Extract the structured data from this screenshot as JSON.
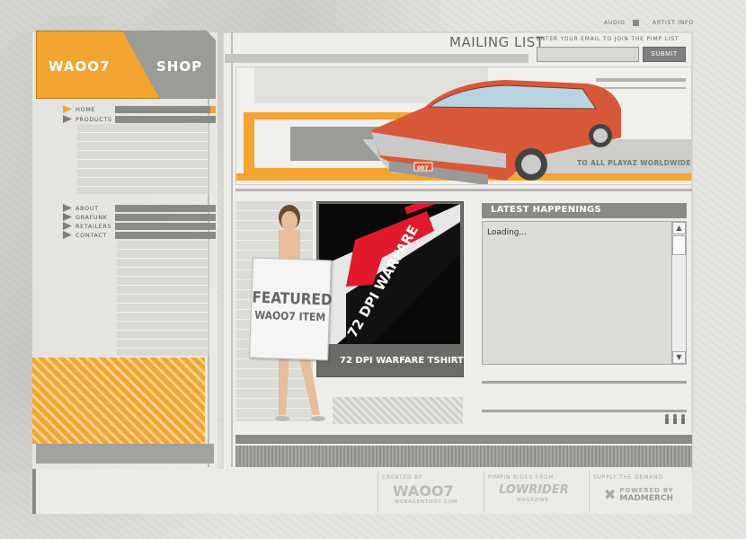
{
  "header": {
    "logo_left": "WAOO7",
    "logo_right": "SHOP",
    "top_links": [
      "AUDIO",
      "ARTIST INFO"
    ],
    "mailing": {
      "title": "MAILING LIST",
      "prompt": "ENTER YOUR EMAIL TO JOIN THE PIMP LIST",
      "input_value": "",
      "submit_label": "SUBMIT"
    }
  },
  "nav": {
    "primary": [
      {
        "label": "HOME",
        "active": true
      },
      {
        "label": "PRODUCTS",
        "active": false
      }
    ],
    "secondary": [
      {
        "label": "ABOUT"
      },
      {
        "label": "GRAFUNK"
      },
      {
        "label": "RETAILERS"
      },
      {
        "label": "CONTACT"
      }
    ]
  },
  "hero": {
    "tagline": "TO ALL PLAYAZ WORLDWIDE",
    "plate": "007"
  },
  "featured": {
    "sign_line1": "FEATURED",
    "sign_line2": "WAOO7 ITEM",
    "product_title": "72 DPI WARFARE",
    "product_label": "72 DPI WARFARE TSHIRT"
  },
  "news": {
    "title": "LATEST HAPPENINGS",
    "text": "Loading...",
    "scroll_up": "▲",
    "scroll_down": "▼"
  },
  "footer": {
    "created_by": "CREATED BY",
    "created_logo": "WAOO7",
    "created_url": "WEBAGENTOO7.COM",
    "rides_from": "PIMPIN RIDES FROM",
    "rides_logo": "LOWRIDER",
    "rides_sub": "MAGAZINE",
    "supply": "SUPPLY THE DEMAND",
    "supply_logo1": "POWERED BY",
    "supply_logo2": "MADMERCH"
  },
  "colors": {
    "accent": "#f2a531",
    "panel_gray": "#8a8a86",
    "background": "#e6e5e1"
  }
}
